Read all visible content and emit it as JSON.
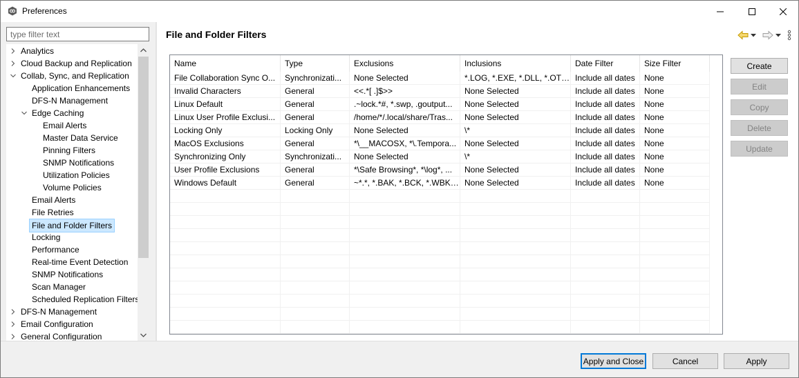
{
  "window": {
    "title": "Preferences"
  },
  "filter": {
    "placeholder": "type filter text",
    "value": ""
  },
  "tree": {
    "items": [
      {
        "label": "Analytics",
        "level": 0,
        "toggle": "collapsed"
      },
      {
        "label": "Cloud Backup and Replication",
        "level": 0,
        "toggle": "collapsed"
      },
      {
        "label": "Collab, Sync, and Replication",
        "level": 0,
        "toggle": "expanded"
      },
      {
        "label": "Application Enhancements",
        "level": 1,
        "toggle": "none"
      },
      {
        "label": "DFS-N Management",
        "level": 1,
        "toggle": "none"
      },
      {
        "label": "Edge Caching",
        "level": 1,
        "toggle": "expanded"
      },
      {
        "label": "Email Alerts",
        "level": 2,
        "toggle": "none"
      },
      {
        "label": "Master Data Service",
        "level": 2,
        "toggle": "none"
      },
      {
        "label": "Pinning Filters",
        "level": 2,
        "toggle": "none"
      },
      {
        "label": "SNMP Notifications",
        "level": 2,
        "toggle": "none"
      },
      {
        "label": "Utilization Policies",
        "level": 2,
        "toggle": "none"
      },
      {
        "label": "Volume Policies",
        "level": 2,
        "toggle": "none"
      },
      {
        "label": "Email Alerts",
        "level": 1,
        "toggle": "none"
      },
      {
        "label": "File Retries",
        "level": 1,
        "toggle": "none"
      },
      {
        "label": "File and Folder Filters",
        "level": 1,
        "toggle": "none",
        "selected": true
      },
      {
        "label": "Locking",
        "level": 1,
        "toggle": "none"
      },
      {
        "label": "Performance",
        "level": 1,
        "toggle": "none"
      },
      {
        "label": "Real-time Event Detection",
        "level": 1,
        "toggle": "none"
      },
      {
        "label": "SNMP Notifications",
        "level": 1,
        "toggle": "none"
      },
      {
        "label": "Scan Manager",
        "level": 1,
        "toggle": "none"
      },
      {
        "label": "Scheduled Replication Filters",
        "level": 1,
        "toggle": "none"
      },
      {
        "label": "DFS-N Management",
        "level": 0,
        "toggle": "collapsed"
      },
      {
        "label": "Email Configuration",
        "level": 0,
        "toggle": "collapsed"
      },
      {
        "label": "General Configuration",
        "level": 0,
        "toggle": "collapsed"
      }
    ]
  },
  "page": {
    "title": "File and Folder Filters"
  },
  "table": {
    "columns": [
      "Name",
      "Type",
      "Exclusions",
      "Inclusions",
      "Date Filter",
      "Size Filter"
    ],
    "rows": [
      [
        "File Collaboration Sync O...",
        "Synchronizati...",
        "None Selected",
        "*.LOG, *.EXE, *.DLL, *.OTF,...",
        "Include all dates",
        "None"
      ],
      [
        "Invalid Characters",
        "General",
        "<<.*[ .]$>>",
        "None Selected",
        "Include all dates",
        "None"
      ],
      [
        "Linux Default",
        "General",
        ".~lock.*#, *.swp, .goutput...",
        "None Selected",
        "Include all dates",
        "None"
      ],
      [
        "Linux User Profile Exclusi...",
        "General",
        "/home/*/.local/share/Tras...",
        "None Selected",
        "Include all dates",
        "None"
      ],
      [
        "Locking Only",
        "Locking Only",
        "None Selected",
        "\\*",
        "Include all dates",
        "None"
      ],
      [
        "MacOS Exclusions",
        "General",
        "*\\__MACOSX, *\\.Tempora...",
        "None Selected",
        "Include all dates",
        "None"
      ],
      [
        "Synchronizing Only",
        "Synchronizati...",
        "None Selected",
        "\\*",
        "Include all dates",
        "None"
      ],
      [
        "User Profile Exclusions",
        "General",
        "*\\Safe Browsing*, *\\log*, ...",
        "None Selected",
        "Include all dates",
        "None"
      ],
      [
        "Windows Default",
        "General",
        "~*.*, *.BAK, *.BCK, *.WBK,...",
        "None Selected",
        "Include all dates",
        "None"
      ]
    ]
  },
  "side_buttons": {
    "create": "Create",
    "edit": "Edit",
    "copy": "Copy",
    "delete": "Delete",
    "update": "Update"
  },
  "footer": {
    "apply_close": "Apply and Close",
    "cancel": "Cancel",
    "apply": "Apply"
  },
  "colors": {
    "selection": "#cce8ff",
    "back_arrow": "#e8b400",
    "default_button_border": "#0078d7"
  }
}
